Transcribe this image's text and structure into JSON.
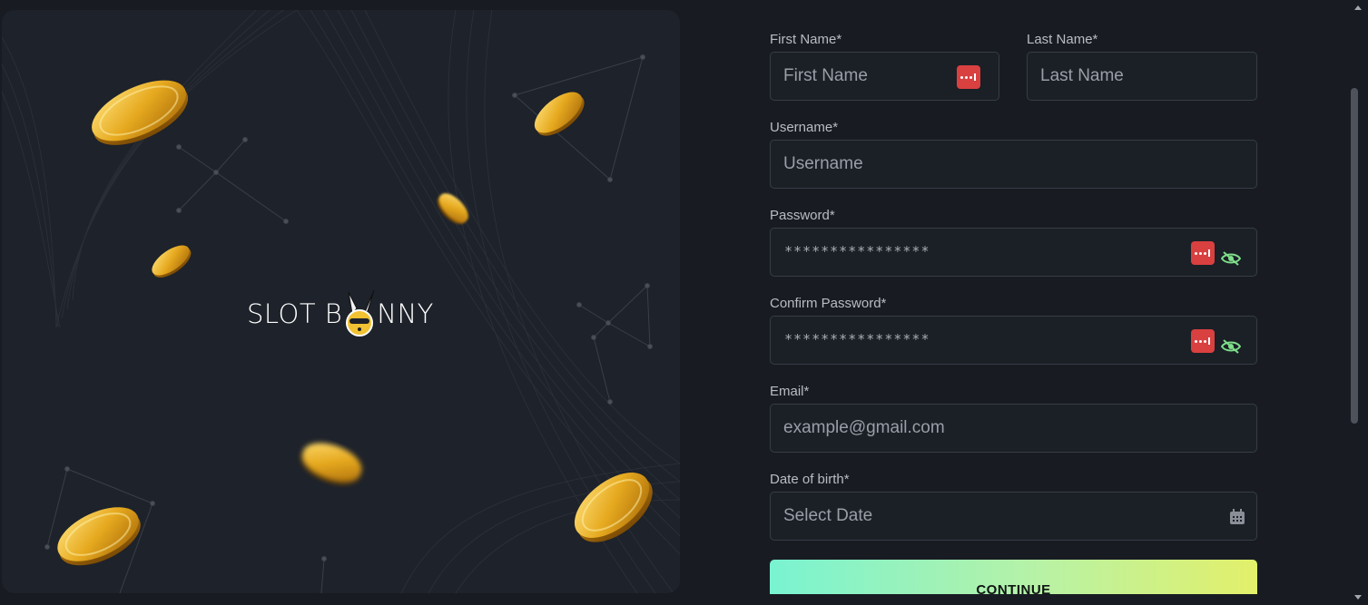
{
  "brand": {
    "logo_left": "SLOT B",
    "logo_right": "NNY"
  },
  "form": {
    "first_name": {
      "label": "First Name*",
      "placeholder": "First Name"
    },
    "last_name": {
      "label": "Last Name*",
      "placeholder": "Last Name"
    },
    "username": {
      "label": "Username*",
      "placeholder": "Username"
    },
    "password": {
      "label": "Password*",
      "value": "****************"
    },
    "confirm_password": {
      "label": "Confirm Password*",
      "value": "****************"
    },
    "email": {
      "label": "Email*",
      "placeholder": "example@gmail.com"
    },
    "dob": {
      "label": "Date of birth*",
      "placeholder": "Select Date"
    },
    "continue_label": "CONTINUE"
  },
  "icons": {
    "password_manager": "password-manager-icon",
    "toggle_visibility": "eye-off-icon",
    "calendar": "calendar-icon"
  },
  "colors": {
    "page_bg": "#181c22",
    "panel_bg": "#1e222a",
    "field_border": "#373b44",
    "pm_icon": "#d94040",
    "eye_icon": "#7ee08a",
    "button_gradient_start": "#79f3d1",
    "button_gradient_end": "#e3f06a"
  }
}
